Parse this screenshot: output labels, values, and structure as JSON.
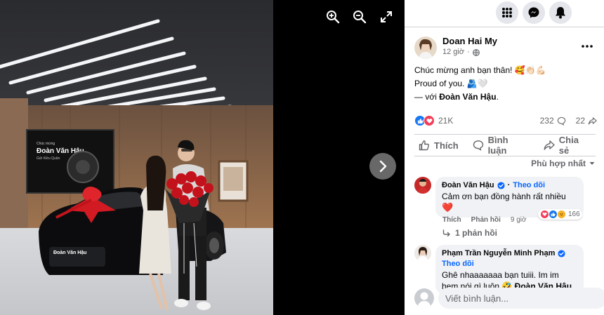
{
  "viewer": {
    "photo_caption_small": "Chúc mừng",
    "photo_screen_name": "Đoàn Văn Hậu",
    "photo_screen_sub": "Gửi Kiều Quân",
    "photo_plate": "Đoàn Văn Hậu",
    "zoom_in_icon": "zoom-in-icon",
    "zoom_out_icon": "zoom-out-icon",
    "fullscreen_icon": "fullscreen-icon",
    "next_icon": "chevron-right-icon"
  },
  "topbar": {
    "icons": [
      "menu-grid-icon",
      "messenger-icon",
      "notifications-bell-icon"
    ]
  },
  "post": {
    "author": "Doan Hai My",
    "time": "12 giờ",
    "audience_icon": "globe-icon",
    "line1": "Chúc mừng anh bạn thân! 🥰👏🏻💪🏻",
    "line2": "Proud of you. 🫂🤍",
    "with_prefix": "— với ",
    "with_tag": "Đoàn Văn Hậu",
    "with_suffix": ".",
    "reactions_count": "21K",
    "comments_count": "232",
    "shares_count": "22"
  },
  "actions": {
    "like": "Thích",
    "comment": "Bình luận",
    "share": "Chia sẻ"
  },
  "sort": {
    "label": "Phù hợp nhất"
  },
  "comments": [
    {
      "name": "Đoàn Văn Hậu",
      "follow": "Theo dõi",
      "text": "Cảm ơn bạn đồng hành rất nhiều",
      "emoji": "❤️",
      "like": "Thích",
      "reply": "Phản hồi",
      "time": "9 giờ",
      "reaction_count": "166",
      "replies": "1 phản hồi"
    },
    {
      "name": "Phạm Trần Nguyễn Minh Phạm",
      "follow": "Theo dõi",
      "text_a": "Ghê nhaaaaaaa bạn tuiii. Im im",
      "text_b": "hem nói gì luôn 🤣 ",
      "tag": "Đoàn Văn Hậu"
    }
  ],
  "write": {
    "placeholder": "Viết bình luận..."
  },
  "colors": {
    "accent": "#0866ff",
    "like_blue": "#1877f2",
    "love_red": "#f33e58",
    "text_secondary": "#65676b"
  }
}
